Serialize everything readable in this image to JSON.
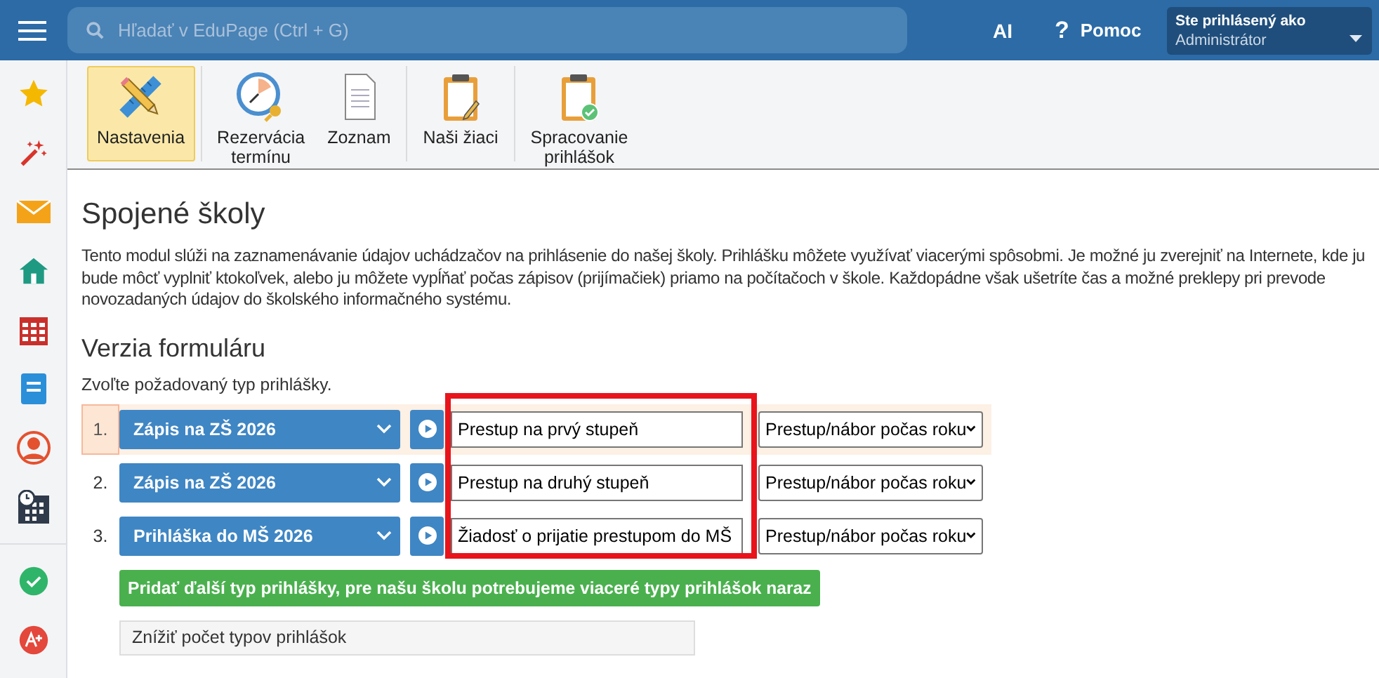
{
  "topbar": {
    "search": {
      "placeholder": "Hľadať v EduPage (Ctrl + G)"
    },
    "ai": "AI",
    "help": {
      "icon": "?",
      "label": "Pomoc"
    },
    "user": {
      "caption": "Ste prihlásený ako",
      "name": "Administrátor"
    }
  },
  "toolbar": [
    [
      {
        "label": "Nastavenia",
        "selected": true
      }
    ],
    [
      {
        "label": "Rezervácia\ntermínu",
        "selected": false
      },
      {
        "label": "Zoznam",
        "selected": false
      }
    ],
    [
      {
        "label": "Naši žiaci",
        "selected": false
      }
    ],
    [
      {
        "label": "Spracovanie\nprihlášok",
        "selected": false
      }
    ]
  ],
  "title": "Spojené školy",
  "intro": "Tento modul slúži na zaznamenávanie údajov uchádzačov na prihlásenie do našej školy. Prihlášku môžete využívať viacerými spôsobmi. Je možné ju zverejniť na Internete, kde ju bude môcť vyplniť ktokoľvek, alebo ju môžete vypĺňať počas zápisov (prijímačiek) priamo na počítačoch v škole. Každopádne však ušetríte čas a možné preklepy pri prevode novozadaných údajov do školského informačného systému.",
  "section": "Verzia formuláru",
  "prompt": "Zvoľte požadovaný typ prihlášky.",
  "rows": [
    {
      "number": "1.",
      "form": "Zápis na ZŠ 2026",
      "name": "Prestup na prvý stupeň",
      "category": "Prestup/nábor počas roku",
      "selected": true
    },
    {
      "number": "2.",
      "form": "Zápis na ZŠ 2026",
      "name": "Prestup na druhý stupeň",
      "category": "Prestup/nábor počas roku",
      "selected": false
    },
    {
      "number": "3.",
      "form": "Prihláška do MŠ 2026",
      "name": "Žiadosť o prijatie prestupom do MŠ",
      "category": "Prestup/nábor počas roku",
      "selected": false
    }
  ],
  "add_button": "Pridať ďalší typ prihlášky, pre našu školu potrebujeme viaceré typy prihlášok naraz",
  "reduce_button": "Znížiť počet typov prihlášok"
}
